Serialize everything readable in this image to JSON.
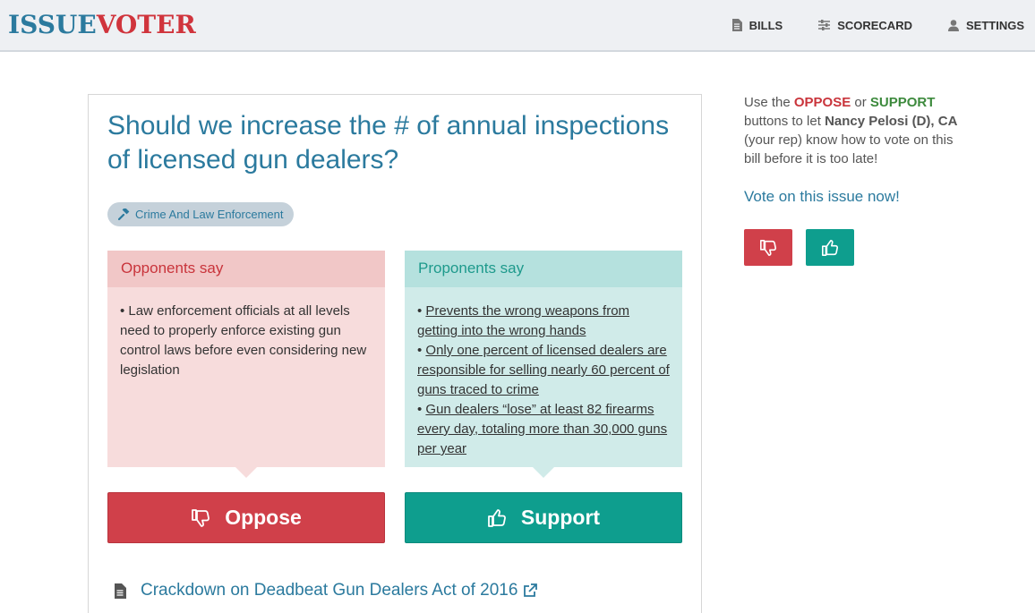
{
  "header": {
    "logo_part1": "ISSUE",
    "logo_part2": "VOTER",
    "nav": [
      {
        "label": "BILLS",
        "icon": "document-icon"
      },
      {
        "label": "SCORECARD",
        "icon": "sliders-icon"
      },
      {
        "label": "SETTINGS",
        "icon": "user-icon"
      }
    ]
  },
  "issue": {
    "title": "Should we increase the # of annual inspections of licensed gun dealers?",
    "tag": "Crime And Law Enforcement",
    "opponents": {
      "heading": "Opponents say",
      "points": [
        "• Law enforcement officials at all levels need to properly enforce existing gun control laws before even considering new legislation"
      ]
    },
    "proponents": {
      "heading": "Proponents say",
      "points": [
        "Prevents the wrong weapons from getting into the wrong hands",
        "Only one percent of licensed dealers are responsible for selling nearly 60 percent of guns traced to crime",
        "Gun dealers “lose” at least 82 firearms every day, totaling more than 30,000 guns per year"
      ]
    },
    "oppose_label": "Oppose",
    "support_label": "Support",
    "bill_title": "Crackdown on Deadbeat Gun Dealers Act of 2016"
  },
  "sidebar": {
    "text_before": "Use the ",
    "oppose_word": "OPPOSE",
    "text_or": " or ",
    "support_word": "SUPPORT",
    "text_mid": " buttons to let ",
    "rep": "Nancy Pelosi (D), CA",
    "text_after": " (your rep) know how to vote on this bill before it is too late!",
    "cta": "Vote on this issue now!"
  },
  "colors": {
    "brand_blue": "#2b7a9e",
    "brand_red": "#d0343c",
    "oppose": "#d0404a",
    "support": "#0e9e8e"
  }
}
